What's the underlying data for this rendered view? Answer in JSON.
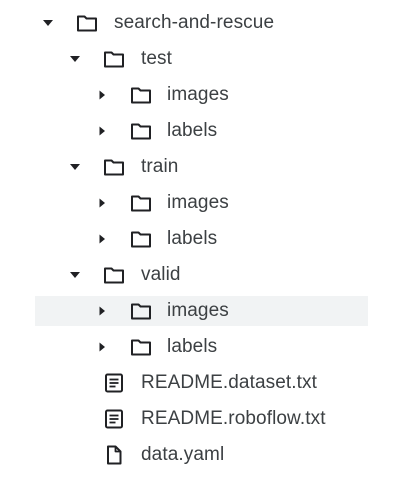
{
  "tree": {
    "root": {
      "label": "search-and-rescue"
    },
    "test": {
      "label": "test",
      "images": "images",
      "labels": "labels"
    },
    "train": {
      "label": "train",
      "images": "images",
      "labels": "labels"
    },
    "valid": {
      "label": "valid",
      "images": "images",
      "labels": "labels"
    },
    "files": {
      "readme_dataset": "README.dataset.txt",
      "readme_roboflow": "README.roboflow.txt",
      "data_yaml": "data.yaml"
    }
  },
  "icons": {
    "expanded": "caret-down-icon",
    "collapsed": "caret-right-icon",
    "folder": "folder-icon",
    "text_file": "text-file-icon",
    "file": "file-icon"
  },
  "colors": {
    "text": "#3c4043",
    "icon": "#202124",
    "selected_row": "#f1f3f4"
  }
}
